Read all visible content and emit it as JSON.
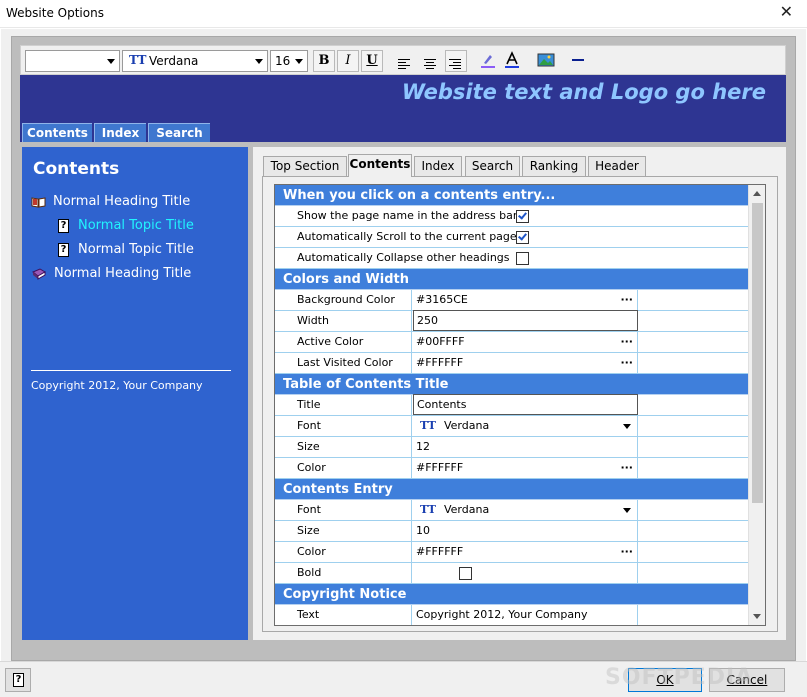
{
  "window": {
    "title": "Website Options",
    "close": "✕"
  },
  "toolbar": {
    "style_value": "",
    "font_value": "Verdana",
    "size_value": "16",
    "bold": "B",
    "italic": "I",
    "underline": "U",
    "font_icon": "TT"
  },
  "banner": {
    "text": "Website text and Logo go here"
  },
  "topnav": [
    "Contents",
    "Index",
    "Search"
  ],
  "leftpane": {
    "heading": "Contents",
    "items": [
      {
        "label": "Normal Heading Title",
        "icon": "book-open-icon"
      },
      {
        "label": "Normal Topic Title",
        "icon": "help-page-icon",
        "active": true
      },
      {
        "label": "Normal Topic Title",
        "icon": "help-page-icon"
      },
      {
        "label": "Normal Heading Title",
        "icon": "book-closed-icon"
      }
    ],
    "copyright": "Copyright 2012, Your Company"
  },
  "tabs": [
    "Top Section",
    "Contents",
    "Index",
    "Search",
    "Ranking",
    "Header"
  ],
  "active_tab": "Contents",
  "sections": {
    "click": {
      "title": "When you click on a contents entry...",
      "rows": [
        {
          "label": "Show the page name in the address bar",
          "checked": true
        },
        {
          "label": "Automatically Scroll to the current page",
          "checked": true
        },
        {
          "label": "Automatically Collapse other headings",
          "checked": false
        }
      ]
    },
    "colors": {
      "title": "Colors and Width",
      "bg_label": "Background Color",
      "bg_value": "#3165CE",
      "width_label": "Width",
      "width_value": "250",
      "active_label": "Active Color",
      "active_value": "#00FFFF",
      "visited_label": "Last Visited Color",
      "visited_value": "#FFFFFF"
    },
    "toc": {
      "title": "Table of Contents Title",
      "title_label": "Title",
      "title_value": "Contents",
      "font_label": "Font",
      "font_value": "Verdana",
      "size_label": "Size",
      "size_value": "12",
      "color_label": "Color",
      "color_value": "#FFFFFF"
    },
    "entry": {
      "title": "Contents Entry",
      "font_label": "Font",
      "font_value": "Verdana",
      "size_label": "Size",
      "size_value": "10",
      "color_label": "Color",
      "color_value": "#FFFFFF",
      "bold_label": "Bold",
      "bold_checked": false
    },
    "copyright": {
      "title": "Copyright Notice",
      "text_label": "Text",
      "text_value": "Copyright 2012, Your Company"
    }
  },
  "ellipsis": "···",
  "footer": {
    "ok": "OK",
    "cancel": "Cancel",
    "help_icon": "?"
  },
  "watermark": "SOFTPEDIA",
  "colors": {
    "banner": "#2e3592",
    "leftpane": "#2f63cf",
    "section": "#3f7fdb",
    "active_item": "#21f4ff",
    "banner_text": "#8ec6ff"
  }
}
